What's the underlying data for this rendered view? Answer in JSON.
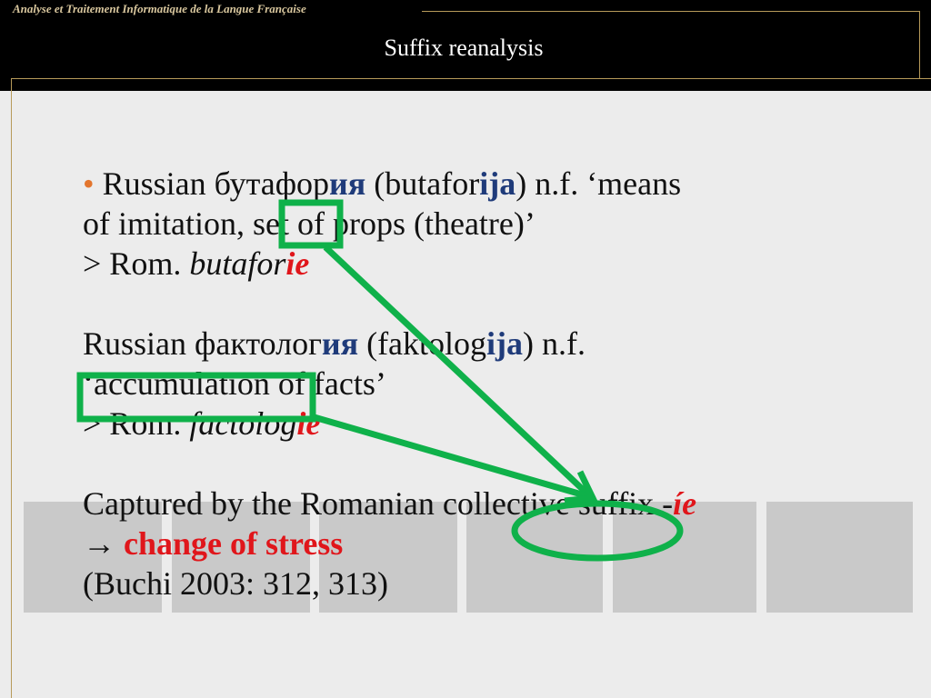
{
  "header": {
    "org": "Analyse et Traitement Informatique de la Langue Française",
    "title": "Suffix  reanalysis"
  },
  "colors": {
    "accent_green": "#0fb14a",
    "bullet_orange": "#e3752d",
    "highlight_blue": "#1f3b7a",
    "highlight_red": "#e0161b"
  },
  "content": {
    "item1": {
      "bullet": "•",
      "l1_pre": "Russian бутафор",
      "l1_bold_cyr": "ия",
      "l1_mid": " (butafor",
      "l1_bold_lat": "ija",
      "l1_post": ") n.f. ‘means",
      "l2_pre": "of imitation, ",
      "l2_box": "set",
      "l2_post": " of props (theatre)’",
      "l3_pre": "> Rom. ",
      "l3_it": "butafor",
      "l3_red": "ie"
    },
    "item2": {
      "l1_pre": "Russian фактолог",
      "l1_bold_cyr": "ия",
      "l1_mid": " (faktolog",
      "l1_bold_lat": "ija",
      "l1_post": ") n.f.",
      "l2_box": "‘accumulation",
      "l2_post": " of facts’",
      "l3_pre": "> Rom. ",
      "l3_it": "factolog",
      "l3_red": "ie"
    },
    "item3": {
      "l1_pre": "Captured by the Romanian ",
      "l1_circle": "collective",
      "l1_post": " suffix -",
      "l1_red": "íe",
      "l2_arrow": "→ ",
      "l2_red": "change of stress",
      "l3": "(Buchi 2003: 312, 313)"
    }
  }
}
